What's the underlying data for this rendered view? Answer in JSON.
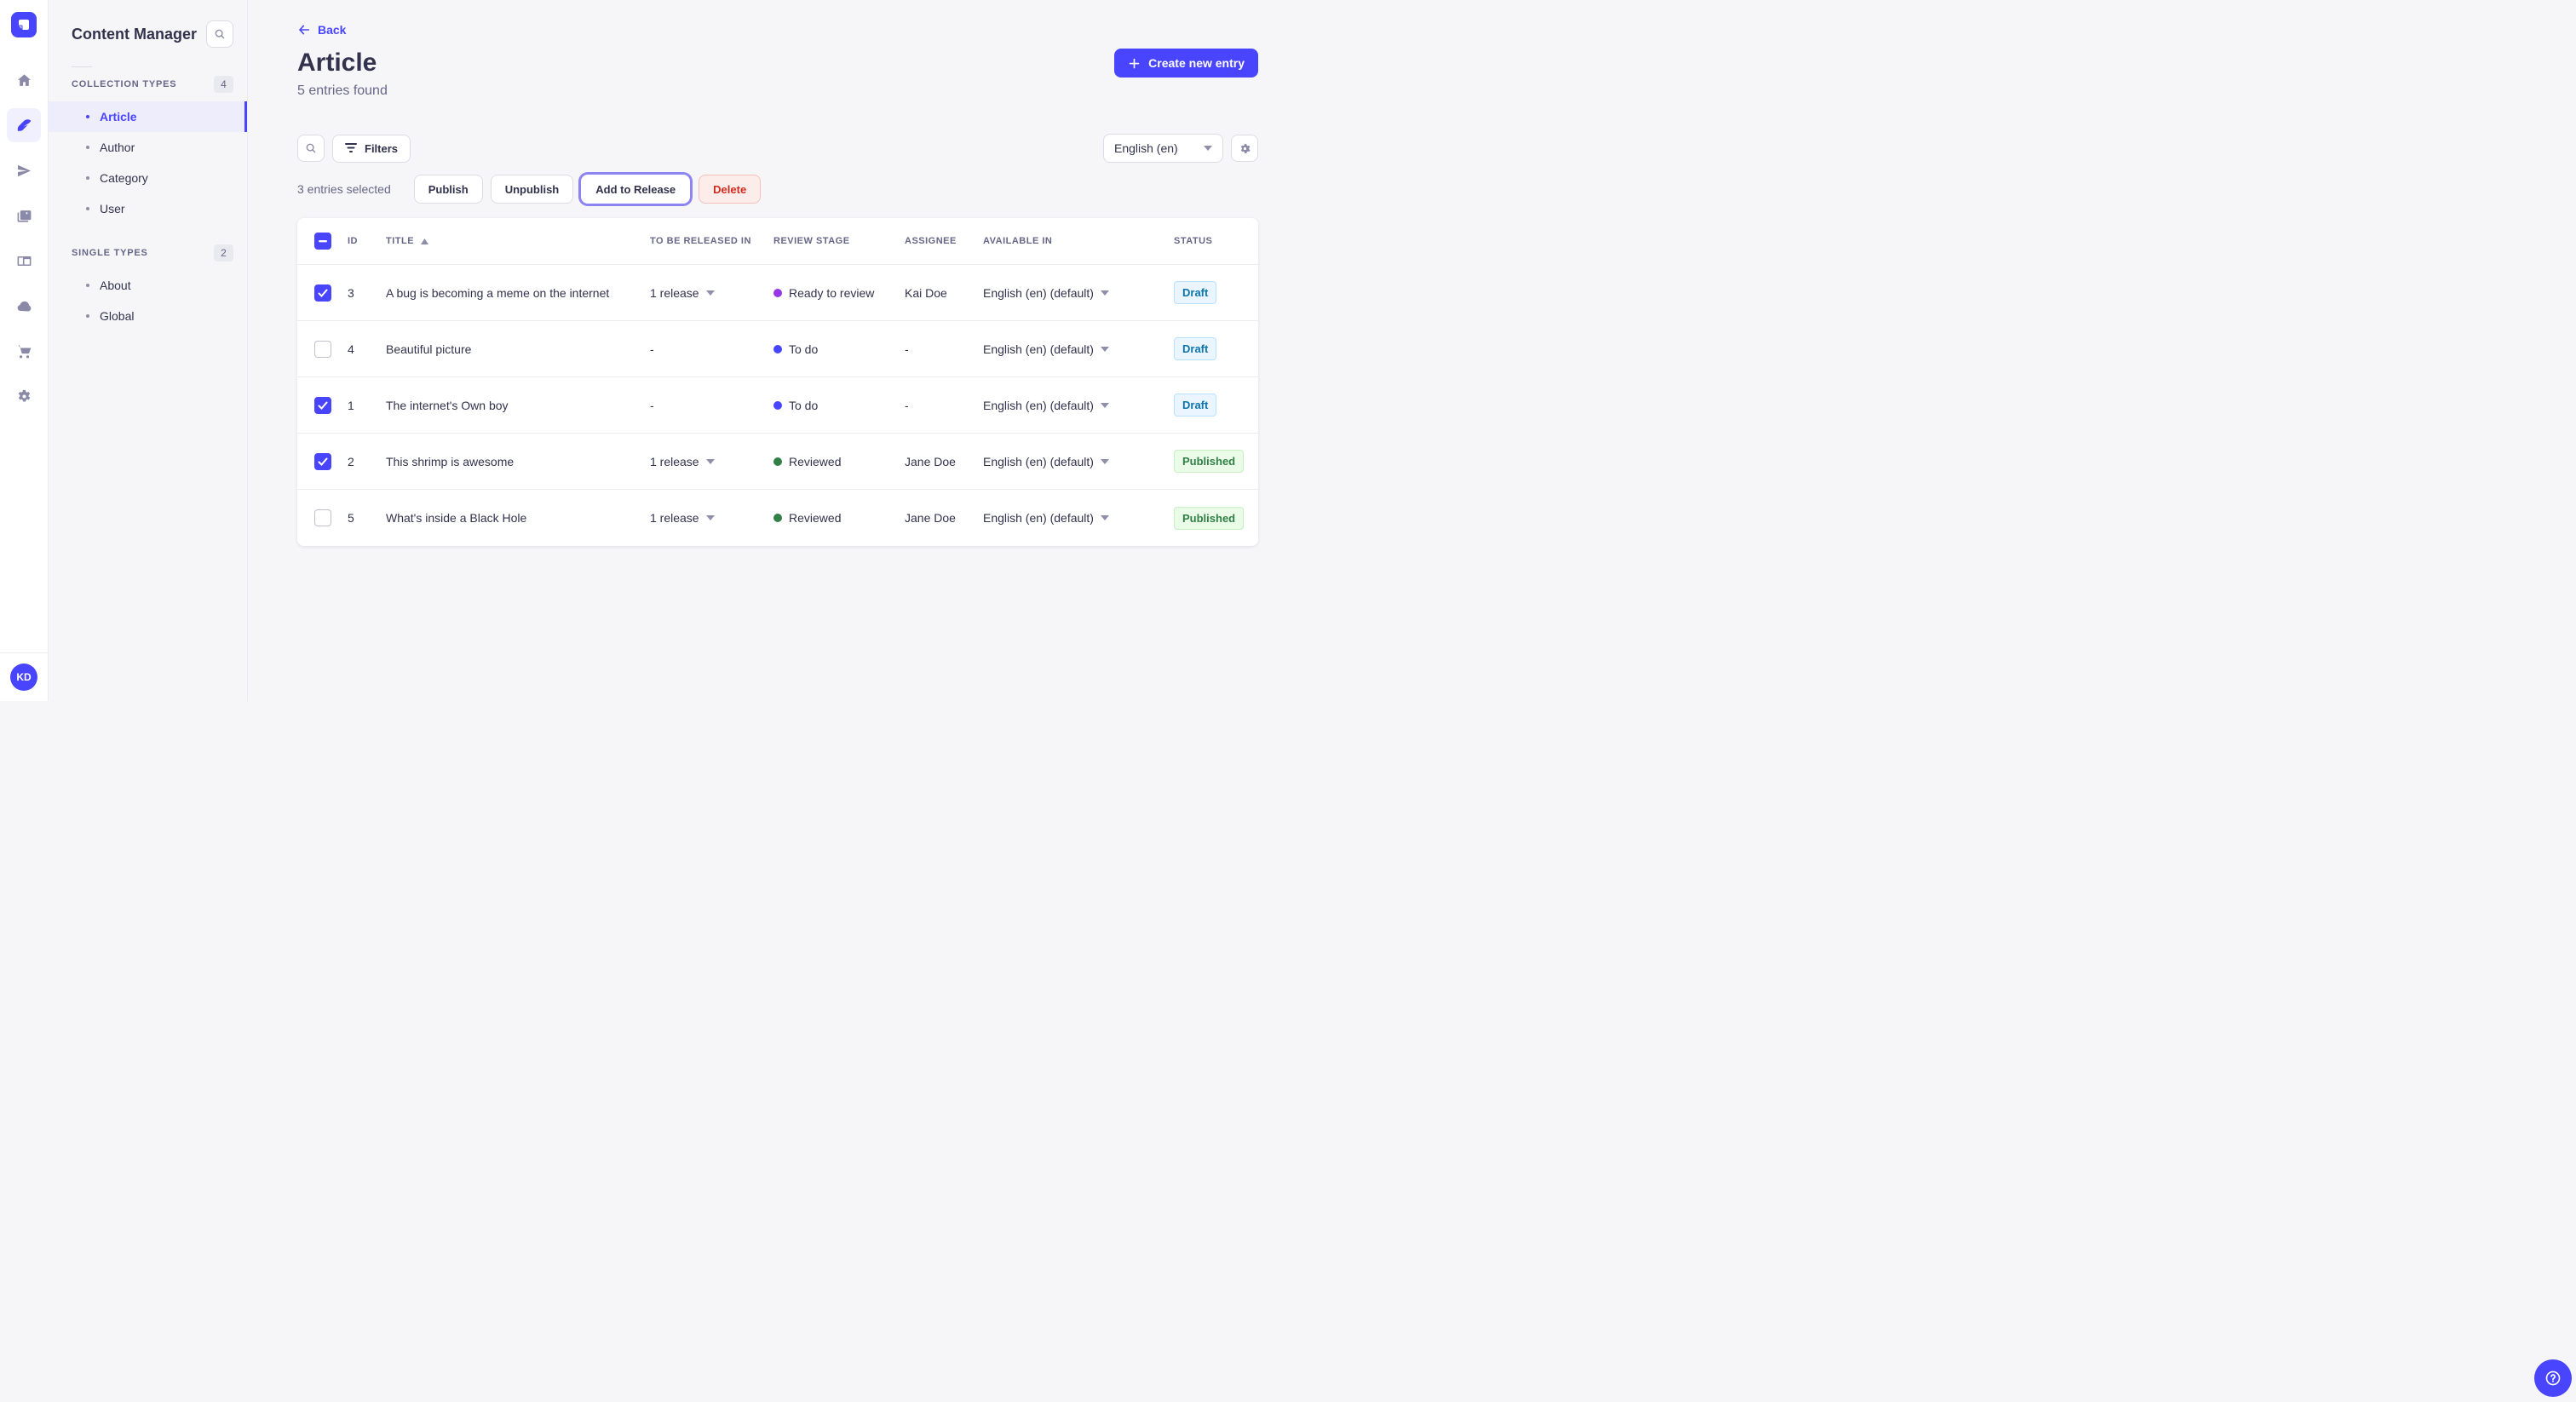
{
  "nav_rail": {
    "logo_icon": "strapi-logo",
    "icons": [
      "home-icon",
      "content-manager-icon",
      "releases-icon",
      "media-library-icon",
      "content-type-builder-icon",
      "cloud-icon",
      "marketplace-icon",
      "settings-icon"
    ],
    "active_icon": "content-manager-icon",
    "avatar_initials": "KD"
  },
  "sidebar": {
    "title": "Content Manager",
    "search_icon": "search-icon",
    "sections": [
      {
        "label": "COLLECTION TYPES",
        "count": "4",
        "items": [
          {
            "label": "Article",
            "active": true
          },
          {
            "label": "Author"
          },
          {
            "label": "Category"
          },
          {
            "label": "User"
          }
        ]
      },
      {
        "label": "SINGLE TYPES",
        "count": "2",
        "items": [
          {
            "label": "About"
          },
          {
            "label": "Global"
          }
        ]
      }
    ]
  },
  "header": {
    "back": "Back",
    "title": "Article",
    "subtitle": "5 entries found",
    "create": "Create new entry"
  },
  "toolbar": {
    "filters": "Filters",
    "locale": "English (en)"
  },
  "selection": {
    "count_text": "3 entries selected",
    "publish": "Publish",
    "unpublish": "Unpublish",
    "add_to_release": "Add to Release",
    "delete": "Delete"
  },
  "table": {
    "columns": [
      "ID",
      "TITLE",
      "TO BE RELEASED IN",
      "REVIEW STAGE",
      "ASSIGNEE",
      "AVAILABLE IN",
      "STATUS"
    ],
    "sorted_by": "TITLE",
    "sort_dir": "asc",
    "rows": [
      {
        "checked": true,
        "id": "3",
        "title": "A bug is becoming a meme on the internet",
        "released": "1 release",
        "stage": "Ready to review",
        "stage_color": "#9736e8",
        "assignee": "Kai Doe",
        "locale": "English (en) (default)",
        "status": "Draft"
      },
      {
        "checked": false,
        "id": "4",
        "title": "Beautiful picture",
        "released": "-",
        "stage": "To do",
        "stage_color": "#4945ff",
        "assignee": "-",
        "locale": "English (en) (default)",
        "status": "Draft"
      },
      {
        "checked": true,
        "id": "1",
        "title": "The internet's Own boy",
        "released": "-",
        "stage": "To do",
        "stage_color": "#4945ff",
        "assignee": "-",
        "locale": "English (en) (default)",
        "status": "Draft"
      },
      {
        "checked": true,
        "id": "2",
        "title": "This shrimp is awesome",
        "released": "1 release",
        "stage": "Reviewed",
        "stage_color": "#328048",
        "assignee": "Jane Doe",
        "locale": "English (en) (default)",
        "status": "Published"
      },
      {
        "checked": false,
        "id": "5",
        "title": "What's inside a Black Hole",
        "released": "1 release",
        "stage": "Reviewed",
        "stage_color": "#328048",
        "assignee": "Jane Doe",
        "locale": "English (en) (default)",
        "status": "Published"
      }
    ]
  },
  "colors": {
    "primary": "#4945ff",
    "primary_light": "#f0f0ff",
    "stage_todo": "#4945ff",
    "stage_ready_to_review": "#9736e8",
    "stage_reviewed": "#328048",
    "draft_bg": "#eaf5ff",
    "draft_text": "#0c75af",
    "published_bg": "#eafbe7",
    "published_text": "#328048",
    "danger_text": "#d02b20",
    "danger_bg": "#fcecea"
  }
}
